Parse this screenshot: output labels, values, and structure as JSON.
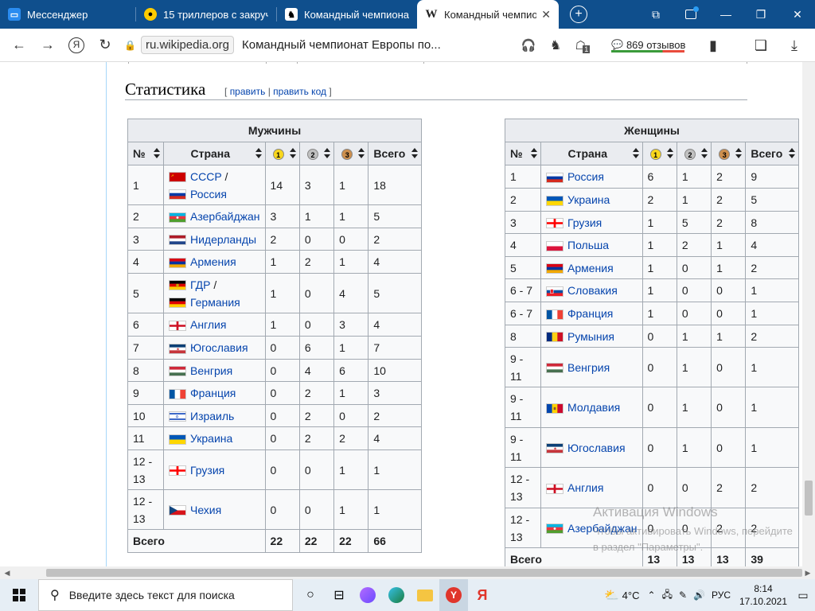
{
  "browser": {
    "tabs": [
      {
        "label": "Мессенджер",
        "icon": "messenger-icon"
      },
      {
        "label": "15 триллеров с закруч",
        "icon": "zen-icon"
      },
      {
        "label": "Командный чемпиона",
        "icon": "chess-icon"
      },
      {
        "label": "Командный чемпио",
        "icon": "wikipedia-icon",
        "active": true
      }
    ],
    "domain": "ru.wikipedia.org",
    "page_title": "Командный чемпионат Европы по...",
    "reviews": "869 отзывов",
    "downloads_badge": "1"
  },
  "article": {
    "section_title": "Статистика",
    "edit_label": "править",
    "edit_code_label": "править код",
    "edit_open": "[",
    "edit_sep": "|",
    "edit_close": "]"
  },
  "men": {
    "caption": "Мужчины",
    "headers": {
      "num": "№",
      "country": "Страна",
      "m1": "1",
      "m2": "2",
      "m3": "3",
      "total": "Всего"
    },
    "rows": [
      {
        "num": "1",
        "c1": "СССР",
        "sep": " /",
        "c2": "Россия",
        "f1": "ussr",
        "f2": "russia",
        "g": "14",
        "s": "3",
        "b": "1",
        "t": "18"
      },
      {
        "num": "2",
        "c1": "Азербайджан",
        "f1": "azerbaijan",
        "g": "3",
        "s": "1",
        "b": "1",
        "t": "5"
      },
      {
        "num": "3",
        "c1": "Нидерланды",
        "f1": "netherlands",
        "g": "2",
        "s": "0",
        "b": "0",
        "t": "2"
      },
      {
        "num": "4",
        "c1": "Армения",
        "f1": "armenia",
        "g": "1",
        "s": "2",
        "b": "1",
        "t": "4"
      },
      {
        "num": "5",
        "c1": "ГДР",
        "sep": " /",
        "c2": "Германия",
        "f1": "gdr",
        "f2": "germany",
        "g": "1",
        "s": "0",
        "b": "4",
        "t": "5"
      },
      {
        "num": "6",
        "c1": "Англия",
        "f1": "england",
        "g": "1",
        "s": "0",
        "b": "3",
        "t": "4"
      },
      {
        "num": "7",
        "c1": "Югославия",
        "f1": "yugoslavia",
        "g": "0",
        "s": "6",
        "b": "1",
        "t": "7"
      },
      {
        "num": "8",
        "c1": "Венгрия",
        "f1": "hungary",
        "g": "0",
        "s": "4",
        "b": "6",
        "t": "10"
      },
      {
        "num": "9",
        "c1": "Франция",
        "f1": "france",
        "g": "0",
        "s": "2",
        "b": "1",
        "t": "3"
      },
      {
        "num": "10",
        "c1": "Израиль",
        "f1": "israel",
        "g": "0",
        "s": "2",
        "b": "0",
        "t": "2"
      },
      {
        "num": "11",
        "c1": "Украина",
        "f1": "ukraine",
        "g": "0",
        "s": "2",
        "b": "2",
        "t": "4"
      },
      {
        "num": "12 - 13",
        "c1": "Грузия",
        "f1": "georgia",
        "g": "0",
        "s": "0",
        "b": "1",
        "t": "1"
      },
      {
        "num": "12 - 13",
        "c1": "Чехия",
        "f1": "czech",
        "g": "0",
        "s": "0",
        "b": "1",
        "t": "1"
      }
    ],
    "total": {
      "label": "Всего",
      "g": "22",
      "s": "22",
      "b": "22",
      "t": "66"
    }
  },
  "women": {
    "caption": "Женщины",
    "headers": {
      "num": "№",
      "country": "Страна",
      "m1": "1",
      "m2": "2",
      "m3": "3",
      "total": "Всего"
    },
    "rows": [
      {
        "num": "1",
        "c1": "Россия",
        "f1": "russia",
        "g": "6",
        "s": "1",
        "b": "2",
        "t": "9"
      },
      {
        "num": "2",
        "c1": "Украина",
        "f1": "ukraine",
        "g": "2",
        "s": "1",
        "b": "2",
        "t": "5"
      },
      {
        "num": "3",
        "c1": "Грузия",
        "f1": "georgia",
        "g": "1",
        "s": "5",
        "b": "2",
        "t": "8"
      },
      {
        "num": "4",
        "c1": "Польша",
        "f1": "poland",
        "g": "1",
        "s": "2",
        "b": "1",
        "t": "4"
      },
      {
        "num": "5",
        "c1": "Армения",
        "f1": "armenia",
        "g": "1",
        "s": "0",
        "b": "1",
        "t": "2"
      },
      {
        "num": "6 - 7",
        "c1": "Словакия",
        "f1": "slovakia",
        "g": "1",
        "s": "0",
        "b": "0",
        "t": "1"
      },
      {
        "num": "6 - 7",
        "c1": "Франция",
        "f1": "france",
        "g": "1",
        "s": "0",
        "b": "0",
        "t": "1"
      },
      {
        "num": "8",
        "c1": "Румыния",
        "f1": "romania",
        "g": "0",
        "s": "1",
        "b": "1",
        "t": "2"
      },
      {
        "num": "9 - 11",
        "c1": "Венгрия",
        "f1": "hungary",
        "g": "0",
        "s": "1",
        "b": "0",
        "t": "1"
      },
      {
        "num": "9 - 11",
        "c1": "Молдавия",
        "f1": "moldova",
        "g": "0",
        "s": "1",
        "b": "0",
        "t": "1"
      },
      {
        "num": "9 - 11",
        "c1": "Югославия",
        "f1": "yugoslavia",
        "g": "0",
        "s": "1",
        "b": "0",
        "t": "1"
      },
      {
        "num": "12 - 13",
        "c1": "Англия",
        "f1": "england",
        "g": "0",
        "s": "0",
        "b": "2",
        "t": "2"
      },
      {
        "num": "12 - 13",
        "c1": "Азербайджан",
        "f1": "azerbaijan",
        "g": "0",
        "s": "0",
        "b": "2",
        "t": "2"
      }
    ],
    "total": {
      "label": "Всего",
      "g": "13",
      "s": "13",
      "b": "13",
      "t": "39"
    }
  },
  "watermark": {
    "line1": "Активация Windows",
    "line2": "Чтобы активировать Windows, перейдите в раздел \"Параметры\"."
  },
  "taskbar": {
    "search_placeholder": "Введите здесь текст для поиска",
    "weather": "4°C",
    "lang": "РУС",
    "time": "8:14",
    "date": "17.10.2021"
  }
}
